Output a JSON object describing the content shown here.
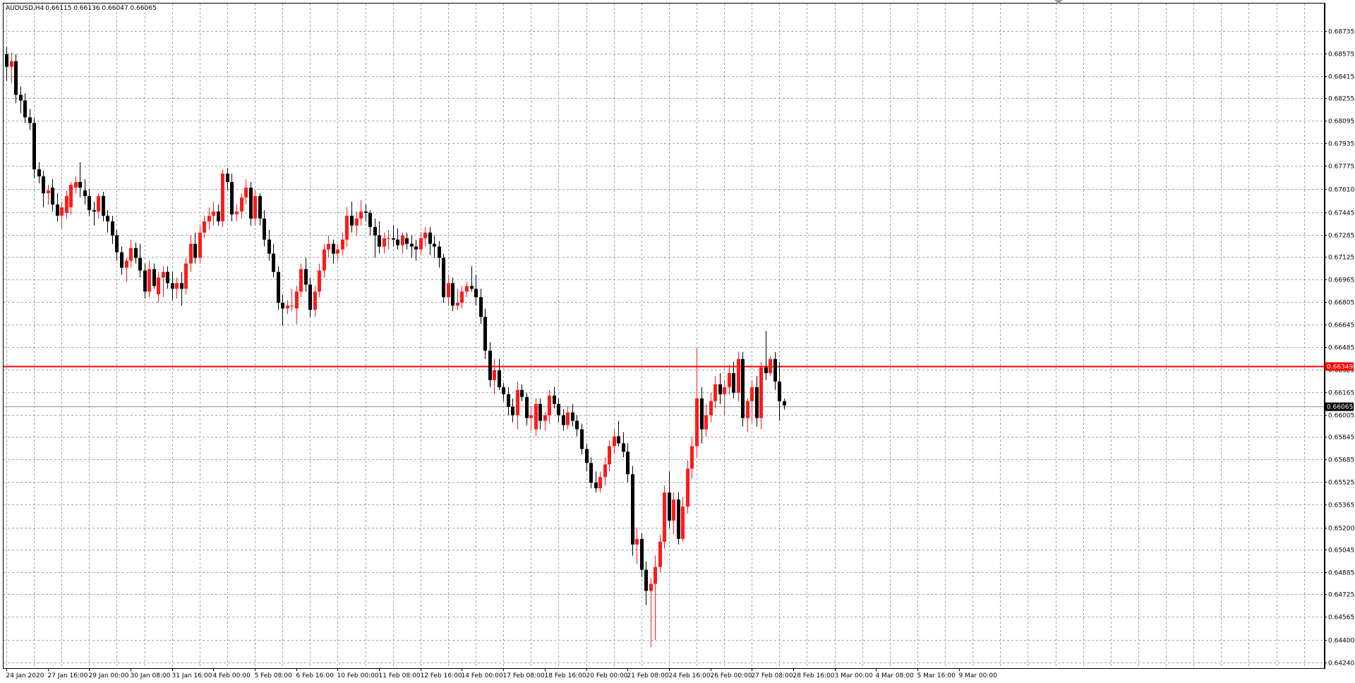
{
  "header": {
    "symbol": "AUDUSD,H4",
    "ohlc": "0.66115 0.66136 0.66047 0.66065"
  },
  "colors": {
    "background": "#ffffff",
    "grid": "#9aa5b1",
    "bull_candle": "#ff1a1a",
    "bear_candle": "#000000",
    "resistance_line": "#ff0000",
    "current_price_line": "#8c96a8",
    "current_price_tag_bg": "#000000",
    "current_price_tag_text": "#ffffff",
    "resistance_tag_bg": "#ff0000",
    "resistance_tag_text": "#ffffff"
  },
  "chart_data": {
    "type": "candlestick",
    "symbol": "AUDUSD",
    "timeframe": "H4",
    "grid": true,
    "ylim": [
      0.6424,
      0.6889
    ],
    "y_ticks": [
      "0.68735",
      "0.68575",
      "0.68415",
      "0.68255",
      "0.68095",
      "0.67935",
      "0.67775",
      "0.67610",
      "0.67445",
      "0.67285",
      "0.67125",
      "0.66965",
      "0.66805",
      "0.66645",
      "0.66485",
      "0.66325",
      "0.66165",
      "0.66005",
      "0.65845",
      "0.65685",
      "0.65525",
      "0.65365",
      "0.65200",
      "0.65045",
      "0.64885",
      "0.64725",
      "0.64565",
      "0.64400",
      "0.64240"
    ],
    "x_ticks": [
      {
        "index": 0,
        "label": "24 Jan 2020"
      },
      {
        "index": 9,
        "label": "27 Jan 16:00"
      },
      {
        "index": 18,
        "label": "29 Jan 00:00"
      },
      {
        "index": 27,
        "label": "30 Jan 08:00"
      },
      {
        "index": 36,
        "label": "31 Jan 16:00"
      },
      {
        "index": 45,
        "label": "4 Feb 00:00"
      },
      {
        "index": 54,
        "label": "5 Feb 08:00"
      },
      {
        "index": 63,
        "label": "6 Feb 16:00"
      },
      {
        "index": 72,
        "label": "10 Feb 00:00"
      },
      {
        "index": 81,
        "label": "11 Feb 08:00"
      },
      {
        "index": 90,
        "label": "12 Feb 16:00"
      },
      {
        "index": 99,
        "label": "14 Feb 00:00"
      },
      {
        "index": 108,
        "label": "17 Feb 08:00"
      },
      {
        "index": 117,
        "label": "18 Feb 16:00"
      },
      {
        "index": 126,
        "label": "20 Feb 00:00"
      },
      {
        "index": 135,
        "label": "21 Feb 08:00"
      },
      {
        "index": 144,
        "label": "24 Feb 16:00"
      },
      {
        "index": 153,
        "label": "26 Feb 00:00"
      },
      {
        "index": 162,
        "label": "27 Feb 08:00"
      },
      {
        "index": 171,
        "label": "28 Feb 16:00"
      },
      {
        "index": 180,
        "label": "3 Mar 00:00"
      },
      {
        "index": 189,
        "label": "4 Mar 08:00"
      },
      {
        "index": 198,
        "label": "5 Mar 16:00"
      },
      {
        "index": 207,
        "label": "9 Mar 00:00"
      }
    ],
    "hlines": [
      {
        "name": "resistance",
        "value": 0.66349,
        "label": "0.66349"
      },
      {
        "name": "current",
        "value": 0.66065,
        "label": "0.66065"
      }
    ],
    "candles": [
      [
        0.6857,
        0.6862,
        0.6838,
        0.6848
      ],
      [
        0.6848,
        0.6858,
        0.6836,
        0.6852
      ],
      [
        0.6852,
        0.6857,
        0.6822,
        0.6828
      ],
      [
        0.6828,
        0.6834,
        0.6815,
        0.6824
      ],
      [
        0.6824,
        0.6829,
        0.6808,
        0.6812
      ],
      [
        0.6812,
        0.6818,
        0.6803,
        0.6808
      ],
      [
        0.6808,
        0.6812,
        0.6769,
        0.6775
      ],
      [
        0.6775,
        0.678,
        0.6765,
        0.677
      ],
      [
        0.677,
        0.6774,
        0.6748,
        0.6758
      ],
      [
        0.6758,
        0.6764,
        0.675,
        0.676
      ],
      [
        0.6762,
        0.6768,
        0.6745,
        0.675
      ],
      [
        0.675,
        0.6758,
        0.6738,
        0.6742
      ],
      [
        0.6742,
        0.6752,
        0.6733,
        0.6748
      ],
      [
        0.6744,
        0.676,
        0.674,
        0.6756
      ],
      [
        0.6748,
        0.6766,
        0.6743,
        0.6764
      ],
      [
        0.6762,
        0.677,
        0.6758,
        0.6766
      ],
      [
        0.6766,
        0.678,
        0.6755,
        0.6762
      ],
      [
        0.676,
        0.6768,
        0.675,
        0.6756
      ],
      [
        0.6756,
        0.6761,
        0.6742,
        0.6746
      ],
      [
        0.6746,
        0.6752,
        0.6735,
        0.6745
      ],
      [
        0.6745,
        0.6758,
        0.674,
        0.6756
      ],
      [
        0.6756,
        0.6759,
        0.6738,
        0.6742
      ],
      [
        0.6742,
        0.6746,
        0.673,
        0.6738
      ],
      [
        0.6738,
        0.6742,
        0.6722,
        0.6728
      ],
      [
        0.6728,
        0.6732,
        0.671,
        0.6716
      ],
      [
        0.6716,
        0.672,
        0.67,
        0.6705
      ],
      [
        0.6705,
        0.6712,
        0.6695,
        0.671
      ],
      [
        0.671,
        0.6725,
        0.6705,
        0.6719
      ],
      [
        0.6719,
        0.6723,
        0.6708,
        0.6712
      ],
      [
        0.6712,
        0.6722,
        0.6698,
        0.6703
      ],
      [
        0.6703,
        0.6708,
        0.6683,
        0.6688
      ],
      [
        0.6688,
        0.671,
        0.6684,
        0.6704
      ],
      [
        0.6704,
        0.6708,
        0.669,
        0.6692
      ],
      [
        0.6686,
        0.6702,
        0.668,
        0.6698
      ],
      [
        0.6698,
        0.6706,
        0.6684,
        0.6702
      ],
      [
        0.6702,
        0.6706,
        0.669,
        0.6694
      ],
      [
        0.6694,
        0.6702,
        0.6682,
        0.669
      ],
      [
        0.669,
        0.6698,
        0.6683,
        0.6694
      ],
      [
        0.6694,
        0.6702,
        0.6678,
        0.669
      ],
      [
        0.669,
        0.6712,
        0.6686,
        0.6708
      ],
      [
        0.6708,
        0.6728,
        0.6702,
        0.6722
      ],
      [
        0.6722,
        0.673,
        0.6708,
        0.6712
      ],
      [
        0.6712,
        0.6735,
        0.6708,
        0.673
      ],
      [
        0.673,
        0.6742,
        0.6726,
        0.6738
      ],
      [
        0.6738,
        0.6748,
        0.6732,
        0.6742
      ],
      [
        0.6742,
        0.6752,
        0.6735,
        0.6745
      ],
      [
        0.6745,
        0.675,
        0.6735,
        0.6738
      ],
      [
        0.6738,
        0.6775,
        0.6734,
        0.6772
      ],
      [
        0.6772,
        0.6776,
        0.676,
        0.6766
      ],
      [
        0.6766,
        0.6772,
        0.6738,
        0.6743
      ],
      [
        0.6743,
        0.675,
        0.6738,
        0.6745
      ],
      [
        0.6745,
        0.6758,
        0.674,
        0.6755
      ],
      [
        0.6755,
        0.6768,
        0.675,
        0.6762
      ],
      [
        0.6762,
        0.6766,
        0.6735,
        0.674
      ],
      [
        0.674,
        0.676,
        0.6735,
        0.6756
      ],
      [
        0.6756,
        0.6758,
        0.6735,
        0.674
      ],
      [
        0.674,
        0.6746,
        0.672,
        0.6725
      ],
      [
        0.6725,
        0.6732,
        0.671,
        0.6715
      ],
      [
        0.6715,
        0.6722,
        0.6698,
        0.6702
      ],
      [
        0.6702,
        0.6706,
        0.6675,
        0.668
      ],
      [
        0.668,
        0.6686,
        0.6664,
        0.6676
      ],
      [
        0.6676,
        0.6682,
        0.6672,
        0.6678
      ],
      [
        0.6678,
        0.669,
        0.6674,
        0.6678
      ],
      [
        0.6676,
        0.6692,
        0.6665,
        0.6688
      ],
      [
        0.6688,
        0.6708,
        0.6684,
        0.6704
      ],
      [
        0.6704,
        0.6712,
        0.6688,
        0.6693
      ],
      [
        0.6693,
        0.6698,
        0.667,
        0.6675
      ],
      [
        0.6675,
        0.6692,
        0.667,
        0.6688
      ],
      [
        0.6688,
        0.6708,
        0.6684,
        0.6703
      ],
      [
        0.6703,
        0.6722,
        0.6698,
        0.6718
      ],
      [
        0.6718,
        0.6728,
        0.6712,
        0.6722
      ],
      [
        0.6722,
        0.6725,
        0.6708,
        0.6715
      ],
      [
        0.6715,
        0.6722,
        0.671,
        0.6718
      ],
      [
        0.6718,
        0.673,
        0.6714,
        0.6725
      ],
      [
        0.6725,
        0.6748,
        0.672,
        0.6742
      ],
      [
        0.6742,
        0.6752,
        0.673,
        0.6735
      ],
      [
        0.6735,
        0.6745,
        0.6728,
        0.674
      ],
      [
        0.674,
        0.6753,
        0.6735,
        0.6745
      ],
      [
        0.6745,
        0.675,
        0.6738,
        0.6744
      ],
      [
        0.6744,
        0.6746,
        0.6728,
        0.6734
      ],
      [
        0.6734,
        0.674,
        0.6712,
        0.6728
      ],
      [
        0.6728,
        0.6738,
        0.6715,
        0.672
      ],
      [
        0.672,
        0.673,
        0.6715,
        0.6726
      ],
      [
        0.6726,
        0.6732,
        0.6718,
        0.6726
      ],
      [
        0.6726,
        0.6735,
        0.672,
        0.6725
      ],
      [
        0.6725,
        0.6733,
        0.6718,
        0.6721
      ],
      [
        0.6721,
        0.673,
        0.6715,
        0.6728
      ],
      [
        0.6726,
        0.673,
        0.6718,
        0.6722
      ],
      [
        0.6722,
        0.6728,
        0.6712,
        0.672
      ],
      [
        0.672,
        0.6725,
        0.671,
        0.6718
      ],
      [
        0.6718,
        0.673,
        0.6714,
        0.6726
      ],
      [
        0.6726,
        0.6734,
        0.672,
        0.673
      ],
      [
        0.673,
        0.6734,
        0.6714,
        0.6722
      ],
      [
        0.6722,
        0.6728,
        0.6712,
        0.672
      ],
      [
        0.672,
        0.6724,
        0.6705,
        0.6712
      ],
      [
        0.6712,
        0.6715,
        0.668,
        0.6684
      ],
      [
        0.6684,
        0.67,
        0.6678,
        0.6694
      ],
      [
        0.6694,
        0.6698,
        0.6674,
        0.6678
      ],
      [
        0.6678,
        0.669,
        0.6675,
        0.668
      ],
      [
        0.668,
        0.6692,
        0.6676,
        0.6688
      ],
      [
        0.6688,
        0.6695,
        0.6684,
        0.6692
      ],
      [
        0.6692,
        0.6706,
        0.6688,
        0.669
      ],
      [
        0.669,
        0.67,
        0.6678,
        0.6684
      ],
      [
        0.6684,
        0.669,
        0.6665,
        0.667
      ],
      [
        0.667,
        0.6676,
        0.664,
        0.6646
      ],
      [
        0.6646,
        0.6652,
        0.662,
        0.6625
      ],
      [
        0.6625,
        0.664,
        0.6615,
        0.6632
      ],
      [
        0.6632,
        0.664,
        0.6618,
        0.662
      ],
      [
        0.662,
        0.6623,
        0.661,
        0.6615
      ],
      [
        0.6615,
        0.662,
        0.66,
        0.6606
      ],
      [
        0.6606,
        0.6612,
        0.6595,
        0.66
      ],
      [
        0.66,
        0.6624,
        0.659,
        0.6618
      ],
      [
        0.6618,
        0.6622,
        0.661,
        0.6613
      ],
      [
        0.6613,
        0.6616,
        0.6593,
        0.6598
      ],
      [
        0.6598,
        0.6606,
        0.6589,
        0.66
      ],
      [
        0.659,
        0.6612,
        0.6585,
        0.6608
      ],
      [
        0.6608,
        0.6612,
        0.659,
        0.6596
      ],
      [
        0.6596,
        0.6602,
        0.6589,
        0.66
      ],
      [
        0.66,
        0.6618,
        0.6594,
        0.6614
      ],
      [
        0.6614,
        0.662,
        0.6605,
        0.6608
      ],
      [
        0.6608,
        0.6612,
        0.6595,
        0.66
      ],
      [
        0.66,
        0.6604,
        0.6589,
        0.6593
      ],
      [
        0.6593,
        0.6606,
        0.659,
        0.6602
      ],
      [
        0.6602,
        0.6608,
        0.6592,
        0.6596
      ],
      [
        0.6596,
        0.66,
        0.6585,
        0.659
      ],
      [
        0.659,
        0.6594,
        0.6572,
        0.6576
      ],
      [
        0.6576,
        0.658,
        0.656,
        0.6566
      ],
      [
        0.6566,
        0.657,
        0.6548,
        0.6552
      ],
      [
        0.6552,
        0.656,
        0.6545,
        0.6548
      ],
      [
        0.6548,
        0.656,
        0.6545,
        0.6556
      ],
      [
        0.6556,
        0.657,
        0.655,
        0.6565
      ],
      [
        0.6565,
        0.6582,
        0.656,
        0.6578
      ],
      [
        0.6578,
        0.659,
        0.6572,
        0.6585
      ],
      [
        0.6585,
        0.6596,
        0.6578,
        0.658
      ],
      [
        0.658,
        0.6588,
        0.657,
        0.6574
      ],
      [
        0.6574,
        0.658,
        0.6552,
        0.6558
      ],
      [
        0.6558,
        0.6564,
        0.65,
        0.6508
      ],
      [
        0.6508,
        0.652,
        0.6494,
        0.6512
      ],
      [
        0.6512,
        0.6516,
        0.6485,
        0.649
      ],
      [
        0.649,
        0.6496,
        0.6465,
        0.6475
      ],
      [
        0.6475,
        0.6484,
        0.6435,
        0.648
      ],
      [
        0.648,
        0.65,
        0.644,
        0.6492
      ],
      [
        0.6492,
        0.6515,
        0.6488,
        0.651
      ],
      [
        0.651,
        0.655,
        0.6505,
        0.6545
      ],
      [
        0.6545,
        0.656,
        0.652,
        0.6525
      ],
      [
        0.6525,
        0.6545,
        0.6515,
        0.654
      ],
      [
        0.654,
        0.6545,
        0.6508,
        0.6512
      ],
      [
        0.6512,
        0.6542,
        0.651,
        0.6535
      ],
      [
        0.6535,
        0.6568,
        0.653,
        0.6562
      ],
      [
        0.6562,
        0.6585,
        0.6555,
        0.6578
      ],
      [
        0.6578,
        0.6648,
        0.657,
        0.6612
      ],
      [
        0.6612,
        0.662,
        0.658,
        0.659
      ],
      [
        0.659,
        0.6608,
        0.6585,
        0.66
      ],
      [
        0.66,
        0.6616,
        0.6595,
        0.661
      ],
      [
        0.661,
        0.6628,
        0.6605,
        0.6622
      ],
      [
        0.6622,
        0.663,
        0.6608,
        0.6615
      ],
      [
        0.6615,
        0.6625,
        0.66,
        0.662
      ],
      [
        0.662,
        0.6636,
        0.6615,
        0.663
      ],
      [
        0.663,
        0.6638,
        0.6612,
        0.6616
      ],
      [
        0.6616,
        0.6645,
        0.661,
        0.664
      ],
      [
        0.664,
        0.6645,
        0.6592,
        0.6598
      ],
      [
        0.6598,
        0.6612,
        0.6588,
        0.661
      ],
      [
        0.661,
        0.6625,
        0.6595,
        0.662
      ],
      [
        0.662,
        0.6628,
        0.6592,
        0.6598
      ],
      [
        0.6598,
        0.6638,
        0.659,
        0.6634
      ],
      [
        0.6634,
        0.666,
        0.6625,
        0.663
      ],
      [
        0.663,
        0.6642,
        0.6628,
        0.664
      ],
      [
        0.664,
        0.6645,
        0.6618,
        0.6624
      ],
      [
        0.6624,
        0.6638,
        0.6596,
        0.661
      ],
      [
        0.661,
        0.6612,
        0.6604,
        0.6607
      ]
    ]
  }
}
